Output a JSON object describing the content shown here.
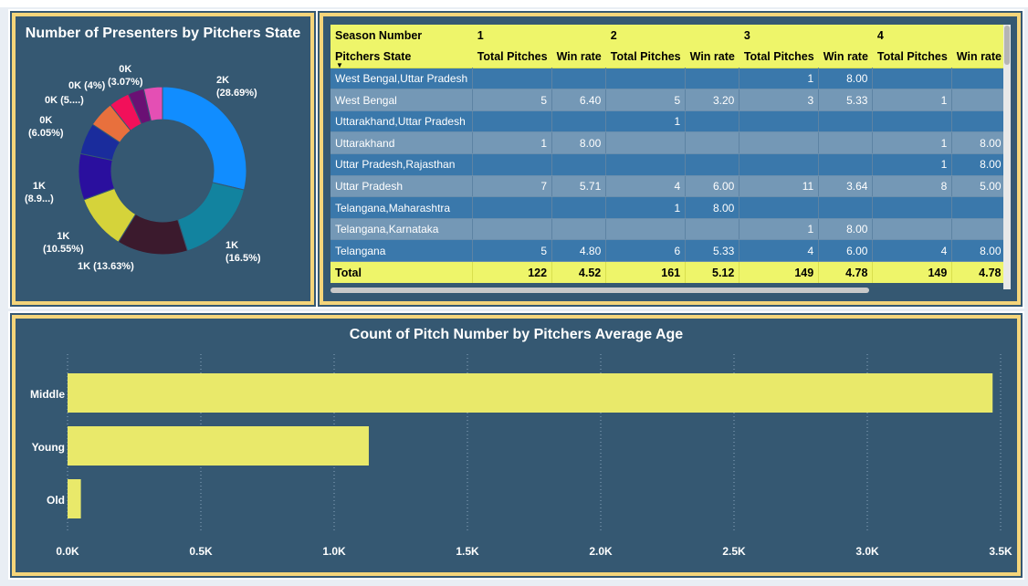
{
  "donut": {
    "title": "Number of Presenters by Pitchers State",
    "colors": {
      "segments": [
        "#118dff",
        "#12839f",
        "#3b1a2d",
        "#d5d33a",
        "#2a0f9e",
        "#1a2c9c",
        "#e8703d",
        "#f2105a",
        "#6a1074",
        "#e44fb4"
      ]
    },
    "segments": [
      28.69,
      16.5,
      13.63,
      10.55,
      8.9,
      6.05,
      5.0,
      4.0,
      3.07,
      3.61
    ],
    "labels": [
      {
        "text": "2K\n(28.69%)"
      },
      {
        "text": "1K\n(16.5%)"
      },
      {
        "text": "1K (13.63%)"
      },
      {
        "text": "1K\n(10.55%)"
      },
      {
        "text": "1K\n(8.9...)"
      },
      {
        "text": "0K\n(6.05%)"
      },
      {
        "text": "0K (5....)"
      },
      {
        "text": "0K (4%)"
      },
      {
        "text": "0K\n(3.07%)"
      }
    ]
  },
  "matrix": {
    "season_label": "Season Number",
    "seasons": [
      "1",
      "2",
      "3",
      "4"
    ],
    "row_header": "Pitchers State",
    "sort_icon": "sort-desc-icon",
    "col_headers": [
      "Total Pitches",
      "Win rate",
      "Total Pitches",
      "Win rate",
      "Total Pitches",
      "Win rate",
      "Total Pitches",
      "Win rate"
    ],
    "rows": [
      {
        "state": "West Bengal,Uttar Pradesh",
        "cells": [
          "",
          "",
          "",
          "",
          "1",
          "8.00",
          "",
          ""
        ]
      },
      {
        "state": "West Bengal",
        "cells": [
          "5",
          "6.40",
          "5",
          "3.20",
          "3",
          "5.33",
          "1",
          ""
        ]
      },
      {
        "state": "Uttarakhand,Uttar Pradesh",
        "cells": [
          "",
          "",
          "1",
          "",
          "",
          "",
          "",
          ""
        ]
      },
      {
        "state": "Uttarakhand",
        "cells": [
          "1",
          "8.00",
          "",
          "",
          "",
          "",
          "1",
          "8.00"
        ]
      },
      {
        "state": "Uttar Pradesh,Rajasthan",
        "cells": [
          "",
          "",
          "",
          "",
          "",
          "",
          "1",
          "8.00"
        ]
      },
      {
        "state": "Uttar Pradesh",
        "cells": [
          "7",
          "5.71",
          "4",
          "6.00",
          "11",
          "3.64",
          "8",
          "5.00"
        ]
      },
      {
        "state": "Telangana,Maharashtra",
        "cells": [
          "",
          "",
          "1",
          "8.00",
          "",
          "",
          "",
          ""
        ]
      },
      {
        "state": "Telangana,Karnataka",
        "cells": [
          "",
          "",
          "",
          "",
          "1",
          "8.00",
          "",
          ""
        ]
      },
      {
        "state": "Telangana",
        "cells": [
          "5",
          "4.80",
          "6",
          "5.33",
          "4",
          "6.00",
          "4",
          "8.00"
        ]
      }
    ],
    "total_label": "Total",
    "totals": [
      "122",
      "4.52",
      "161",
      "5.12",
      "149",
      "4.78",
      "149",
      "4.78"
    ]
  },
  "chart_data": {
    "type": "bar",
    "title": "Count of Pitch Number by Pitchers Average Age",
    "categories": [
      "Middle",
      "Young",
      "Old"
    ],
    "values": [
      3470,
      1130,
      50
    ],
    "xlim": [
      0,
      3500
    ],
    "x_ticks": [
      "0.0K",
      "0.5K",
      "1.0K",
      "1.5K",
      "2.0K",
      "2.5K",
      "3.0K",
      "3.5K"
    ],
    "grid": true,
    "bar_color": "#e9e96a"
  }
}
